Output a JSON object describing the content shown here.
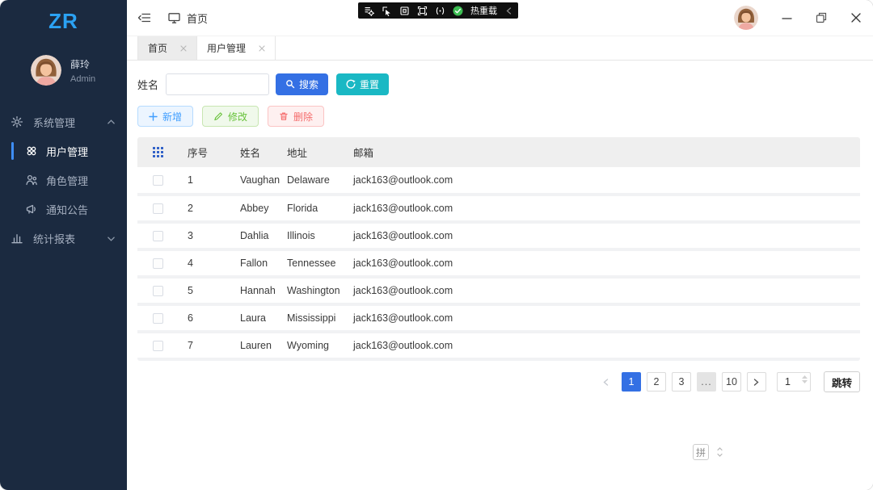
{
  "sidebar": {
    "logo": "ZR",
    "user": {
      "name": "薛玲",
      "role": "Admin"
    },
    "menu": {
      "system": "系统管理",
      "users": "用户管理",
      "roles": "角色管理",
      "notices": "通知公告",
      "reports": "统计报表"
    }
  },
  "header": {
    "breadcrumb": "首页",
    "debug_toolbar": {
      "hot_reload_label": "热重载"
    }
  },
  "tabs": [
    {
      "label": "首页",
      "active": false
    },
    {
      "label": "用户管理",
      "active": true
    }
  ],
  "filters": {
    "name_label": "姓名",
    "name_value": "",
    "search_label": "搜索",
    "reset_label": "重置"
  },
  "toolbar": {
    "add_label": "新增",
    "edit_label": "修改",
    "delete_label": "删除"
  },
  "table": {
    "columns": {
      "no": "序号",
      "name": "姓名",
      "address": "地址",
      "email": "邮箱"
    },
    "rows": [
      {
        "no": "1",
        "name": "Vaughan",
        "address": "Delaware",
        "email": "jack163@outlook.com"
      },
      {
        "no": "2",
        "name": "Abbey",
        "address": "Florida",
        "email": "jack163@outlook.com"
      },
      {
        "no": "3",
        "name": "Dahlia",
        "address": "Illinois",
        "email": "jack163@outlook.com"
      },
      {
        "no": "4",
        "name": "Fallon",
        "address": "Tennessee",
        "email": "jack163@outlook.com"
      },
      {
        "no": "5",
        "name": "Hannah",
        "address": "Washington",
        "email": "jack163@outlook.com"
      },
      {
        "no": "6",
        "name": "Laura",
        "address": "Mississippi",
        "email": "jack163@outlook.com"
      },
      {
        "no": "7",
        "name": "Lauren",
        "address": "Wyoming",
        "email": "jack163@outlook.com"
      }
    ]
  },
  "pagination": {
    "pages": [
      {
        "label": "1",
        "active": true
      },
      {
        "label": "2"
      },
      {
        "label": "3"
      },
      {
        "label": "...",
        "ellipsis": true
      },
      {
        "label": "10"
      }
    ],
    "jump_value": "1",
    "jump_label": "跳转"
  },
  "ime": {
    "indicator": "拼"
  },
  "colors": {
    "sidebar_bg": "#1b2a40",
    "logo_blue": "#2ba2f3",
    "primary_blue": "#3470e4",
    "reset_teal": "#1ab8c4",
    "add_blue": "#409eff",
    "edit_green": "#67c23a",
    "delete_red": "#f56c6c",
    "hot_reload_green": "#3cbd52",
    "active_indicator": "#3e8ef7"
  },
  "icons": {
    "search-icon": "magnifier",
    "reset-icon": "refresh-arrow",
    "add-icon": "plus",
    "edit-icon": "pencil",
    "delete-icon": "trash",
    "column-grid-icon": "3x3-dots",
    "hot-reload-icon": "green-check-circle",
    "ime-arrows-icon": "up-down-triangles"
  }
}
